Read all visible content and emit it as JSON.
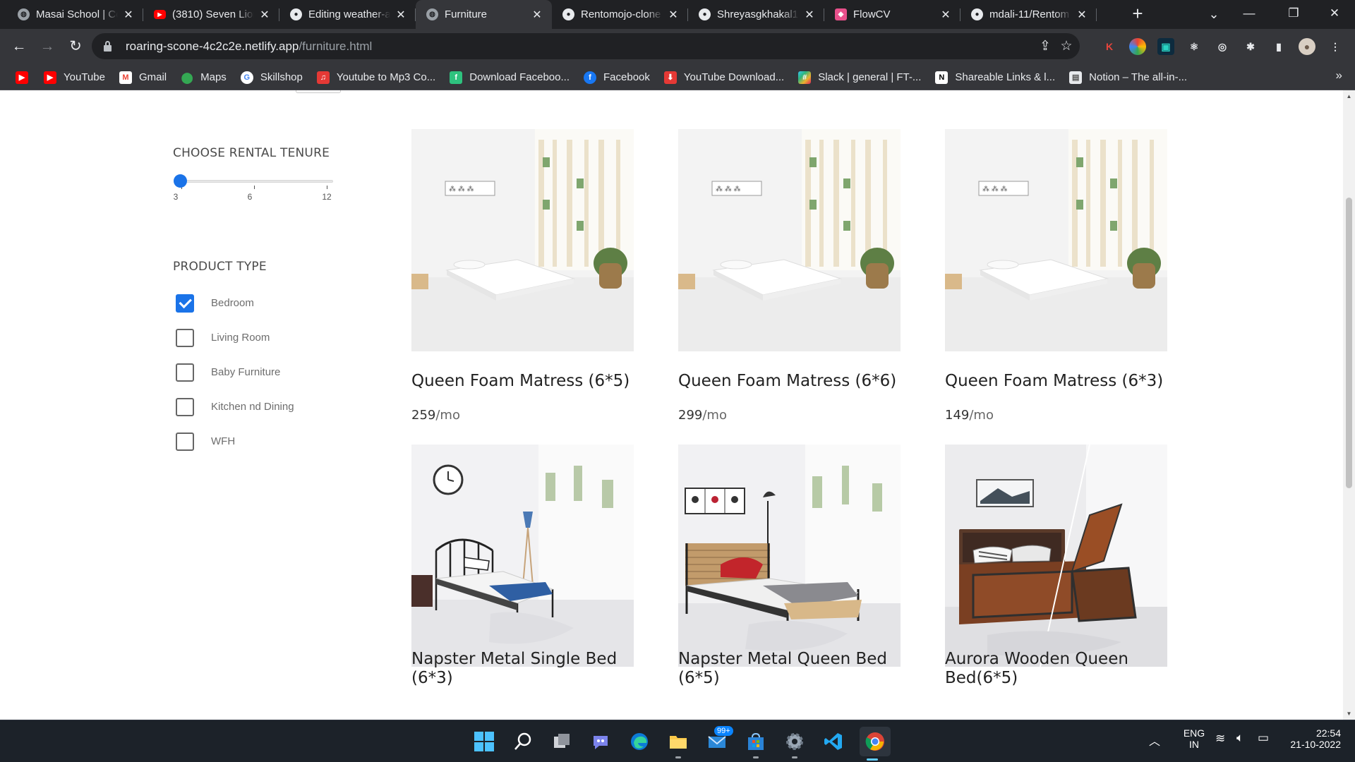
{
  "browser": {
    "tabs": [
      {
        "title": "Masai School | Co",
        "favicon": "globe-icon",
        "active": false
      },
      {
        "title": "(3810) Seven Lion",
        "favicon": "youtube-icon",
        "active": false
      },
      {
        "title": "Editing weather-a",
        "favicon": "github-icon",
        "active": false
      },
      {
        "title": "Furniture",
        "favicon": "globe-icon",
        "active": true
      },
      {
        "title": "Rentomojo-clone",
        "favicon": "github-icon",
        "active": false
      },
      {
        "title": "Shreyasgkhakal10",
        "favicon": "github-icon",
        "active": false
      },
      {
        "title": "FlowCV",
        "favicon": "flowcv-icon",
        "active": false
      },
      {
        "title": "mdali-11/Rentom",
        "favicon": "github-icon",
        "active": false
      }
    ],
    "url_host": "roaring-scone-4c2c2e.netlify.app",
    "url_path": "/furniture.html",
    "bookmarks": [
      {
        "label": "",
        "icon": "youtube-icon",
        "color": "#ff0000"
      },
      {
        "label": "YouTube",
        "icon": "youtube-icon",
        "color": "#ff0000"
      },
      {
        "label": "Gmail",
        "icon": "gmail-icon",
        "color": "#ea4335"
      },
      {
        "label": "Maps",
        "icon": "maps-icon",
        "color": "#34a853"
      },
      {
        "label": "Skillshop",
        "icon": "google-icon",
        "color": "#4285f4"
      },
      {
        "label": "Youtube to Mp3 Co...",
        "icon": "converter-icon",
        "color": "#e53935"
      },
      {
        "label": "Download Faceboo...",
        "icon": "download-icon",
        "color": "#2ec27e"
      },
      {
        "label": "Facebook",
        "icon": "facebook-icon",
        "color": "#1877f2"
      },
      {
        "label": "YouTube Download...",
        "icon": "download-icon",
        "color": "#e53935"
      },
      {
        "label": "Slack | general | FT-...",
        "icon": "slack-icon",
        "color": "#e01e5a"
      },
      {
        "label": "Shareable Links & l...",
        "icon": "notion-icon",
        "color": "#ffffff"
      },
      {
        "label": "Notion – The all-in-...",
        "icon": "notion-page-icon",
        "color": "#ffffff"
      }
    ]
  },
  "filters": {
    "tenure_heading": "CHOOSE RENTAL TENURE",
    "tenure_ticks": [
      "3",
      "6",
      "12"
    ],
    "tenure_value": 3,
    "product_heading": "PRODUCT TYPE",
    "product_types": [
      {
        "label": "Bedroom",
        "checked": true
      },
      {
        "label": "Living Room",
        "checked": false
      },
      {
        "label": "Baby Furniture",
        "checked": false
      },
      {
        "label": "Kitchen nd Dining",
        "checked": false
      },
      {
        "label": "WFH",
        "checked": false
      }
    ]
  },
  "products": [
    {
      "name": "Queen Foam Matress (6*5)",
      "price": "259",
      "unit": "/mo",
      "image": "mattress-photo"
    },
    {
      "name": "Queen Foam Matress (6*6)",
      "price": "299",
      "unit": "/mo",
      "image": "mattress-photo"
    },
    {
      "name": "Queen Foam Matress (6*3)",
      "price": "149",
      "unit": "/mo",
      "image": "mattress-photo"
    },
    {
      "name": "Napster Metal Single Bed (6*3)",
      "price": "",
      "unit": "",
      "image": "metal-single-bed-photo"
    },
    {
      "name": "Napster Metal Queen Bed (6*5)",
      "price": "",
      "unit": "",
      "image": "metal-queen-bed-photo"
    },
    {
      "name": "Aurora Wooden Queen Bed(6*5)",
      "price": "",
      "unit": "",
      "image": "wooden-storage-bed-photo"
    }
  ],
  "taskbar": {
    "apps": [
      "windows-start-icon",
      "search-icon",
      "task-view-icon",
      "teams-chat-icon",
      "edge-icon",
      "file-explorer-icon",
      "mail-icon",
      "microsoft-store-icon",
      "settings-icon",
      "vscode-icon",
      "chrome-icon"
    ],
    "mail_badge": "99+",
    "language": "ENG",
    "region": "IN",
    "time": "22:54",
    "date": "21-10-2022"
  },
  "colors": {
    "accent": "#1a73e8",
    "chrome_dark": "#202124",
    "chrome_toolbar": "#35363a",
    "taskbar": "#1c2229"
  }
}
